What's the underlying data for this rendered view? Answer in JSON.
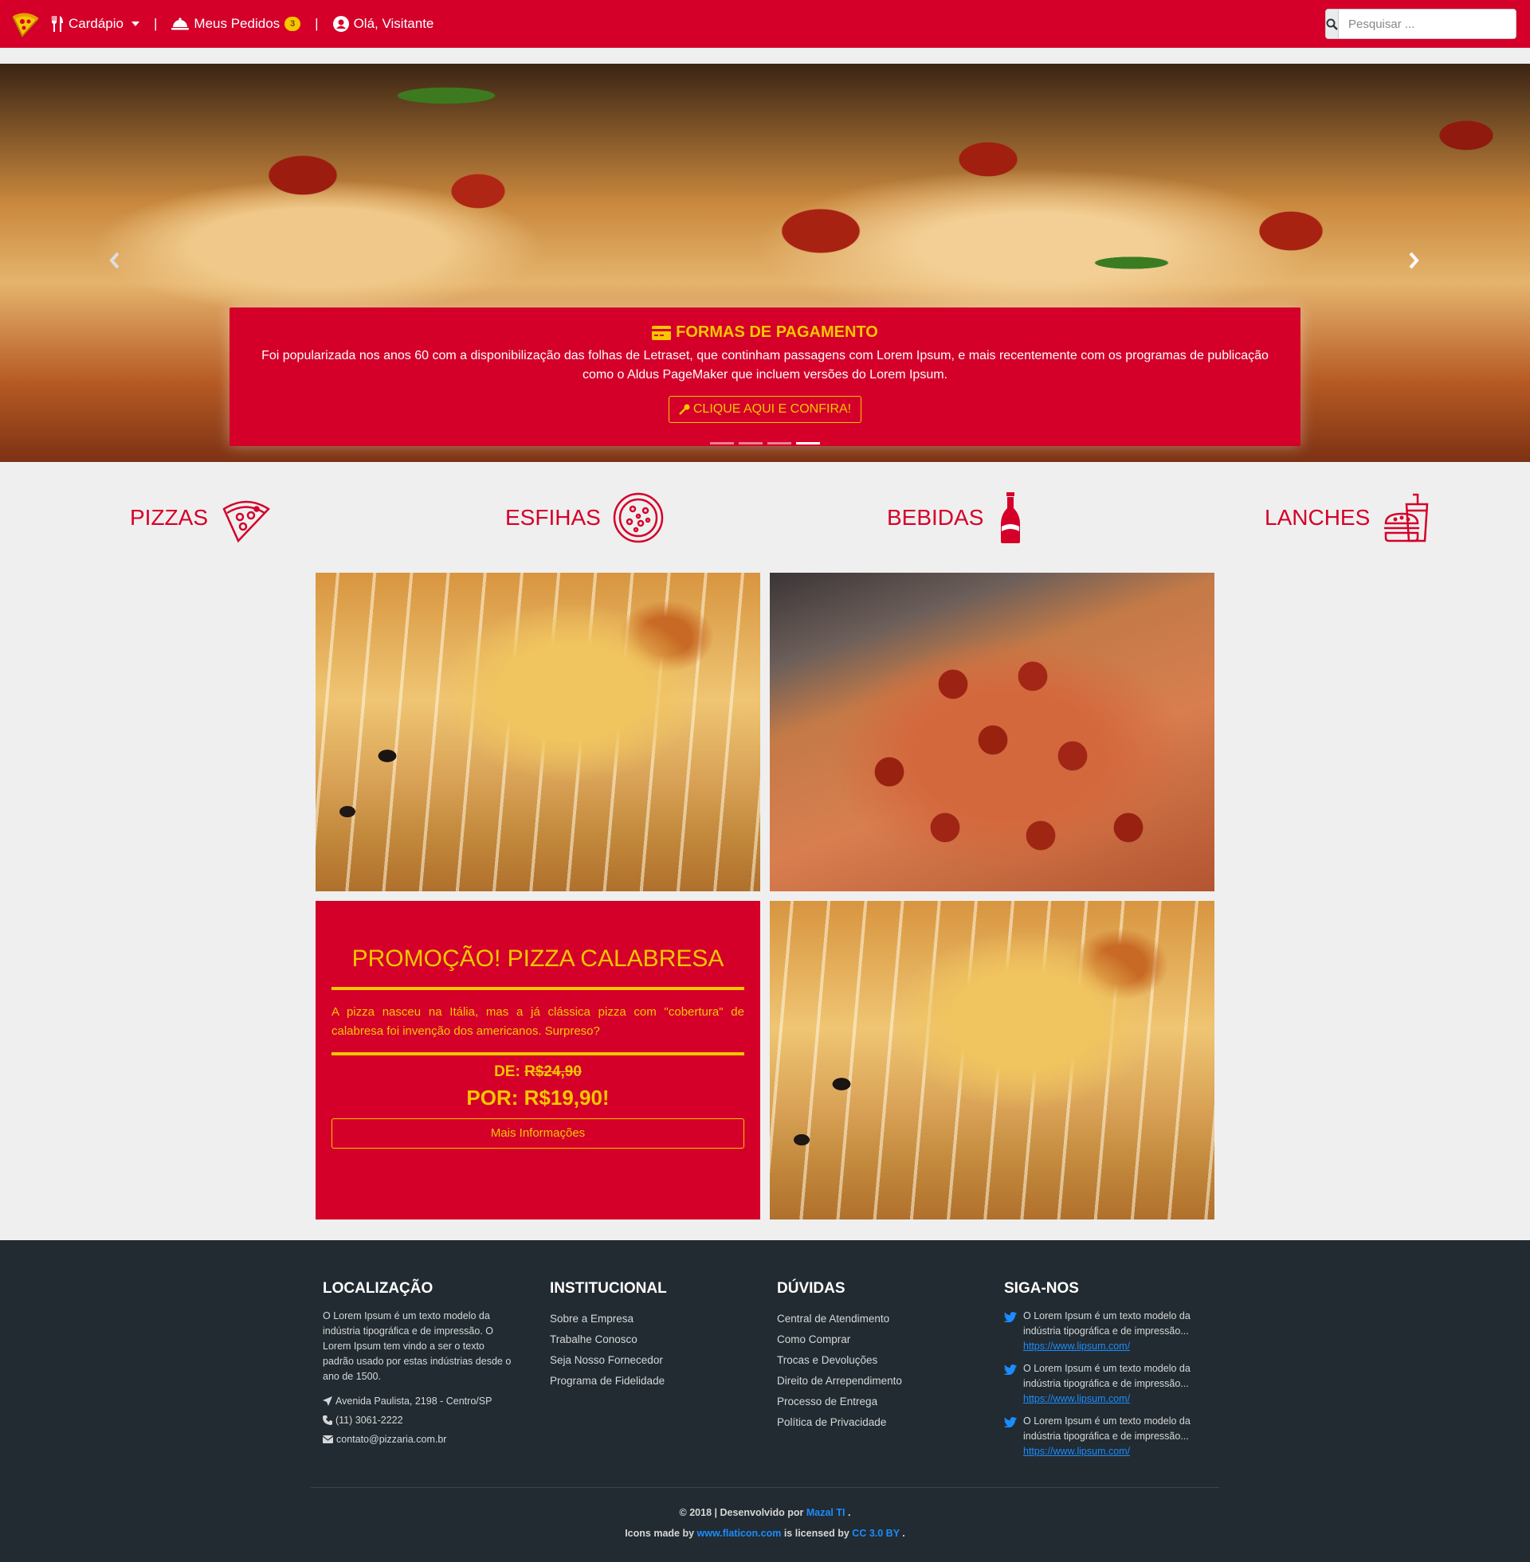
{
  "nav": {
    "menu_label": "Cardápio",
    "orders_label": "Meus Pedidos",
    "orders_count": "3",
    "separator": "|",
    "user_label": "Olá, Visitante",
    "search_placeholder": "Pesquisar ..."
  },
  "hero": {
    "title": "FORMAS DE PAGAMENTO",
    "text": "Foi popularizada nos anos 60 com a disponibilização das folhas de Letraset, que continham passagens com Lorem Ipsum, e mais recentemente com os programas de publicação como o Aldus PageMaker que incluem versões do Lorem Ipsum.",
    "button": "CLIQUE AQUI E CONFIRA!",
    "slides": 4,
    "active_slide": 4
  },
  "categories": [
    {
      "label": "PIZZAS",
      "icon": "pizza-slice-icon"
    },
    {
      "label": "ESFIHAS",
      "icon": "whole-pizza-icon"
    },
    {
      "label": "BEBIDAS",
      "icon": "soda-bottle-icon"
    },
    {
      "label": "LANCHES",
      "icon": "fast-food-icon"
    }
  ],
  "promo": {
    "title": "PROMOÇÃO! PIZZA CALABRESA",
    "text": "A pizza nasceu na Itália, mas a já clássica pizza com \"cobertura\" de calabresa foi invenção dos americanos. Surpreso?",
    "de_label": "DE:",
    "old_price": "R$24,90",
    "new_price": "POR: R$19,90!",
    "button": "Mais Informações"
  },
  "footer": {
    "location": {
      "title": "LOCALIZAÇÃO",
      "text": "O Lorem Ipsum é um texto modelo da indústria tipográfica e de impressão. O Lorem Ipsum tem vindo a ser o texto padrão usado por estas indústrias desde o ano de 1500.",
      "address": "Avenida Paulista, 2198 - Centro/SP",
      "phone": "(11) 3061-2222",
      "email": "contato@pizzaria.com.br"
    },
    "institutional": {
      "title": "INSTITUCIONAL",
      "links": [
        "Sobre a Empresa",
        "Trabalhe Conosco",
        "Seja Nosso Fornecedor",
        "Programa de Fidelidade"
      ]
    },
    "faq": {
      "title": "DÚVIDAS",
      "links": [
        "Central de Atendimento",
        "Como Comprar",
        "Trocas e Devoluções",
        "Direito de Arrependimento",
        "Processo de Entrega",
        "Política de Privacidade"
      ]
    },
    "social": {
      "title": "SIGA-NOS",
      "tweets": [
        {
          "text": "O Lorem Ipsum é um texto modelo da indústria tipográfica e de impressão...",
          "link": "https://www.lipsum.com/"
        },
        {
          "text": "O Lorem Ipsum é um texto modelo da indústria tipográfica e de impressão...",
          "link": "https://www.lipsum.com/"
        },
        {
          "text": "O Lorem Ipsum é um texto modelo da indústria tipográfica e de impressão...",
          "link": "https://www.lipsum.com/"
        }
      ]
    },
    "copyright_prefix": "© 2018 | Desenvolvido por",
    "developer": "Mazal TI",
    "copyright_suffix": ".",
    "icons_prefix": "Icons made by",
    "icons_site": "www.flaticon.com",
    "icons_middle": "is licensed by",
    "license": "CC 3.0 BY",
    "icons_suffix": "."
  },
  "colors": {
    "brand_red": "#d4002a",
    "accent_yellow": "#f7c600",
    "footer_bg": "#222b31",
    "link_blue": "#1a8cff"
  }
}
